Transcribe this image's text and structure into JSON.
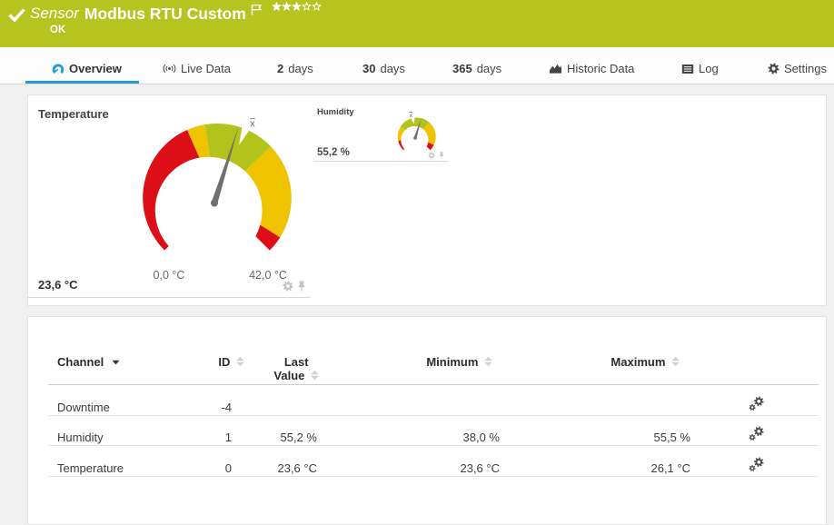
{
  "colors": {
    "header_bg": "#b5c41e",
    "accent": "#1e9bd7",
    "gauge_red": "#dc0f16",
    "gauge_yellow": "#f0c300",
    "gauge_green": "#b2c31c",
    "needle_gray": "#6f6f6f"
  },
  "header": {
    "kind": "Sensor",
    "title": "Modbus RTU Custom",
    "status": "OK",
    "status_icon": "check-icon",
    "flag_icon": "flag-icon",
    "rating": {
      "filled": 3,
      "total": 5
    }
  },
  "tabs": [
    {
      "id": "overview",
      "label": "Overview",
      "icon": "gauge-icon",
      "active": true
    },
    {
      "id": "live-data",
      "label": "Live Data",
      "icon": "live-data-icon"
    },
    {
      "id": "2-days",
      "strong": "2",
      "label": "days"
    },
    {
      "id": "30-days",
      "strong": "30",
      "label": "days"
    },
    {
      "id": "365-days",
      "strong": "365",
      "label": "days"
    },
    {
      "id": "historic-data",
      "label": "Historic Data",
      "icon": "historic-data-icon"
    },
    {
      "id": "log",
      "label": "Log",
      "icon": "log-icon"
    },
    {
      "id": "settings",
      "label": "Settings",
      "icon": "settings-icon"
    }
  ],
  "chart_data": [
    {
      "type": "gauge",
      "channel": "Temperature",
      "value": 23.6,
      "value_label": "23,6 °C",
      "min": 0,
      "max": 42,
      "min_label": "0,0 °C",
      "max_label": "42,0 °C",
      "mean": 24.5,
      "mean_marker_label": "x̄",
      "sweep_degrees": 270,
      "segments": [
        {
          "color": "red",
          "from": 0,
          "to": 17.3
        },
        {
          "color": "yellow",
          "from": 17.3,
          "to": 19.5
        },
        {
          "color": "green",
          "from": 19.5,
          "to": 28.2
        },
        {
          "color": "yellow",
          "from": 28.2,
          "to": 40
        },
        {
          "color": "red",
          "from": 40,
          "to": 42
        }
      ],
      "action_icons": [
        "gear-icon",
        "pin-icon"
      ]
    },
    {
      "type": "gauge",
      "channel": "Humidity",
      "value": 55.2,
      "value_label": "55,2 %",
      "min": 0,
      "max": 100,
      "min_label": "",
      "max_label": "",
      "mean": 45.5,
      "mean_marker_label": "x̄",
      "sweep_degrees": 270,
      "segments": [
        {
          "color": "red",
          "from": 0,
          "to": 12
        },
        {
          "color": "yellow",
          "from": 12,
          "to": 28
        },
        {
          "color": "green",
          "from": 28,
          "to": 65
        },
        {
          "color": "yellow",
          "from": 65,
          "to": 93
        },
        {
          "color": "red",
          "from": 93,
          "to": 100
        }
      ],
      "action_icons": [
        "gear-icon",
        "pin-icon"
      ]
    }
  ],
  "table": {
    "columns": [
      {
        "key": "channel",
        "label": "Channel",
        "sort": "active-desc"
      },
      {
        "key": "id",
        "label": "ID",
        "sort": "both"
      },
      {
        "key": "last_value",
        "label_lines": [
          "Last",
          "Value"
        ],
        "label": "Last Value",
        "sort": "both"
      },
      {
        "key": "minimum",
        "label": "Minimum",
        "sort": "both"
      },
      {
        "key": "maximum",
        "label": "Maximum",
        "sort": "both"
      },
      {
        "key": "actions",
        "label": "",
        "sort": "none",
        "icon": "cogs-icon"
      }
    ],
    "rows": [
      {
        "channel": "Downtime",
        "id": "-4",
        "last_value": "",
        "minimum": "",
        "maximum": ""
      },
      {
        "channel": "Humidity",
        "id": "1",
        "last_value": "55,2 %",
        "minimum": "38,0 %",
        "maximum": "55,5 %"
      },
      {
        "channel": "Temperature",
        "id": "0",
        "last_value": "23,6 °C",
        "minimum": "23,6 °C",
        "maximum": "26,1 °C"
      }
    ]
  }
}
